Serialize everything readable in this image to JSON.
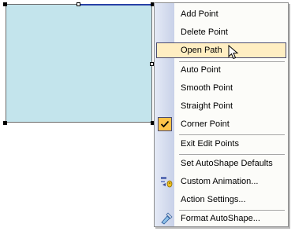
{
  "menu": {
    "items": [
      {
        "label": "Add Point"
      },
      {
        "label": "Delete Point"
      },
      {
        "label": "Open Path",
        "highlighted": true
      },
      {
        "label": "Auto Point"
      },
      {
        "label": "Smooth Point"
      },
      {
        "label": "Straight Point"
      },
      {
        "label": "Corner Point",
        "checked": true
      },
      {
        "label": "Exit Edit Points"
      },
      {
        "label": "Set AutoShape Defaults"
      },
      {
        "label": "Custom Animation...",
        "icon": "custom-animation-icon"
      },
      {
        "label": "Action Settings..."
      },
      {
        "label": "Format AutoShape...",
        "icon": "format-autoshape-icon"
      }
    ]
  },
  "colors": {
    "shape_fill": "#c3e4ec",
    "menu_highlight": "#ffeec2",
    "checked_box": "#ffc34a",
    "edit_edge": "#2840a6"
  }
}
